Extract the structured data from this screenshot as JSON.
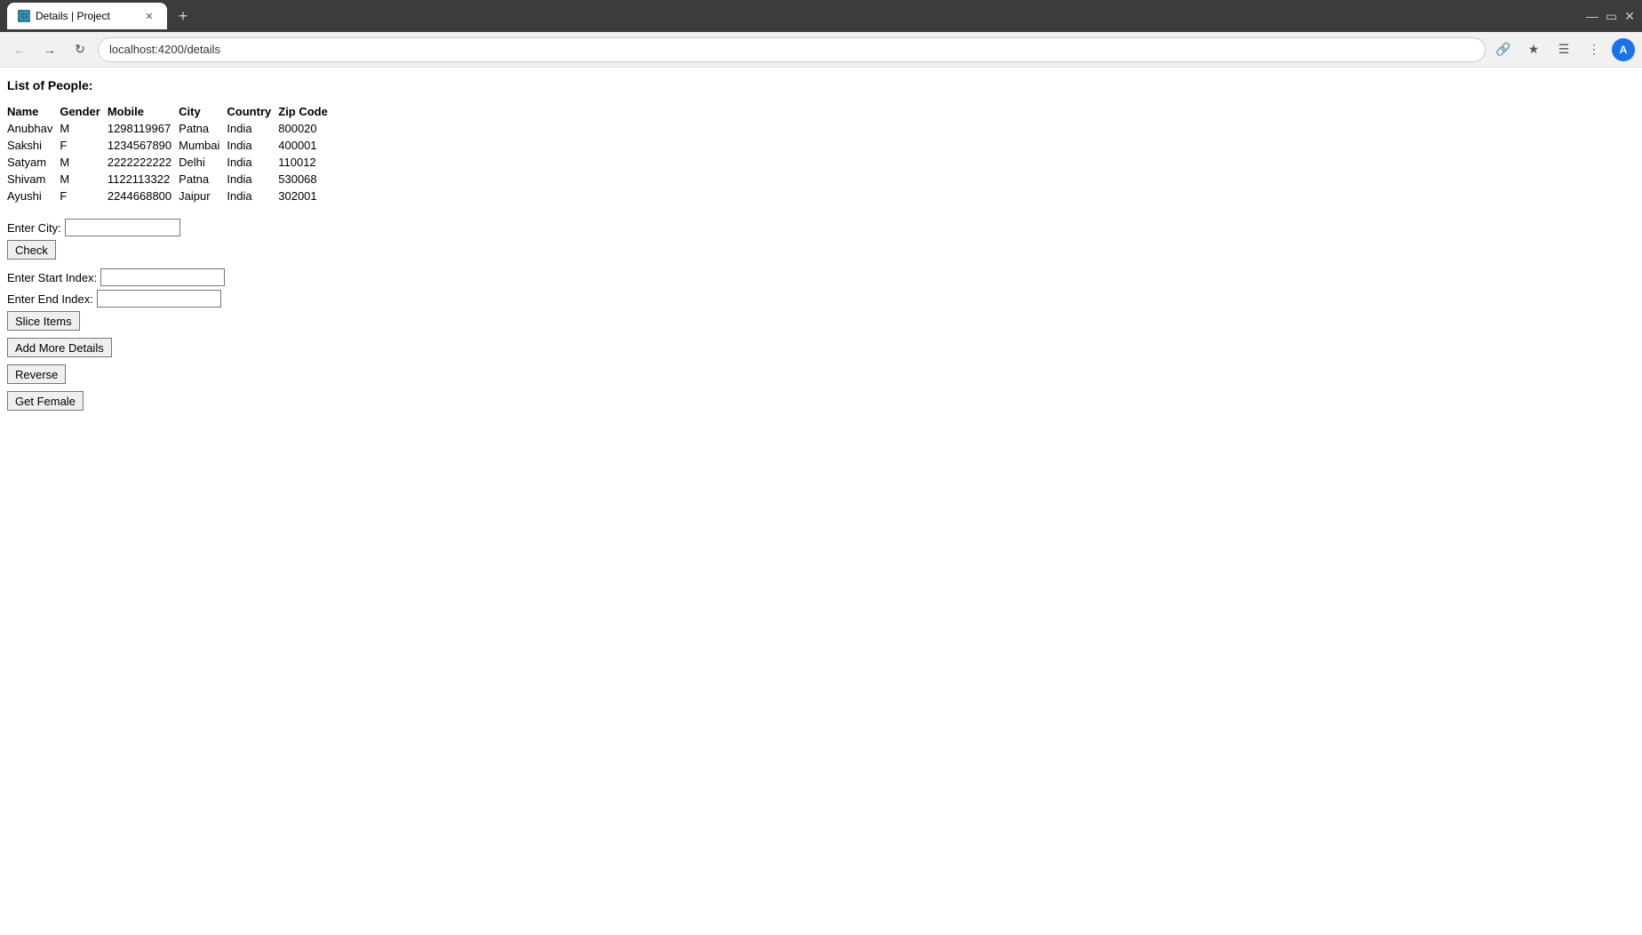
{
  "browser": {
    "tab_title": "Details | Project",
    "tab_favicon": "📄",
    "new_tab_label": "+",
    "address": "localhost:4200/details",
    "nav": {
      "back_title": "Back",
      "forward_title": "Forward",
      "reload_title": "Reload",
      "share_title": "Share",
      "bookmark_title": "Bookmark",
      "extensions_title": "Extensions",
      "menu_title": "Menu"
    }
  },
  "page": {
    "title": "List of People:",
    "table": {
      "headers": [
        "Name",
        "Gender",
        "Mobile",
        "City",
        "Country",
        "Zip Code"
      ],
      "rows": [
        [
          "Anubhav",
          "M",
          "1298119967",
          "Patna",
          "India",
          "800020"
        ],
        [
          "Sakshi",
          "F",
          "1234567890",
          "Mumbai",
          "India",
          "400001"
        ],
        [
          "Satyam",
          "M",
          "2222222222",
          "Delhi",
          "India",
          "110012"
        ],
        [
          "Shivam",
          "M",
          "1122113322",
          "Patna",
          "India",
          "530068"
        ],
        [
          "Ayushi",
          "F",
          "2244668800",
          "Jaipur",
          "India",
          "302001"
        ]
      ]
    },
    "form": {
      "city_label": "Enter City:",
      "city_placeholder": "",
      "check_button": "Check",
      "start_index_label": "Enter Start Index:",
      "start_index_placeholder": "",
      "end_index_label": "Enter End Index:",
      "end_index_placeholder": "",
      "slice_button": "Slice Items",
      "add_more_button": "Add More Details",
      "reverse_button": "Reverse",
      "get_female_button": "Get Female"
    }
  }
}
